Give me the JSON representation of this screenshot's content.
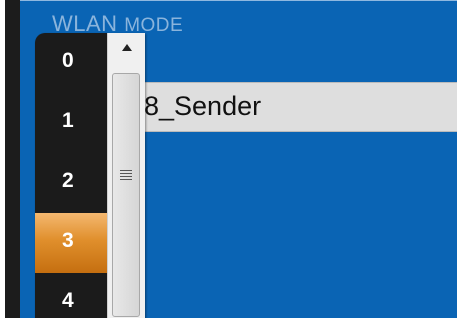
{
  "section": {
    "title_main": "WLAN",
    "title_sub": "MODE"
  },
  "name_field": {
    "value": "8_Sender"
  },
  "dropdown": {
    "items": [
      "0",
      "1",
      "2",
      "3",
      "4"
    ],
    "selected": "3"
  },
  "colors": {
    "panel": "#0a64b4",
    "selected_item": "#e08f2c",
    "list_background": "#1b1b1b"
  },
  "icons": {
    "scroll_up": "chevron-up-icon",
    "thumb_grip": "grip-icon"
  }
}
